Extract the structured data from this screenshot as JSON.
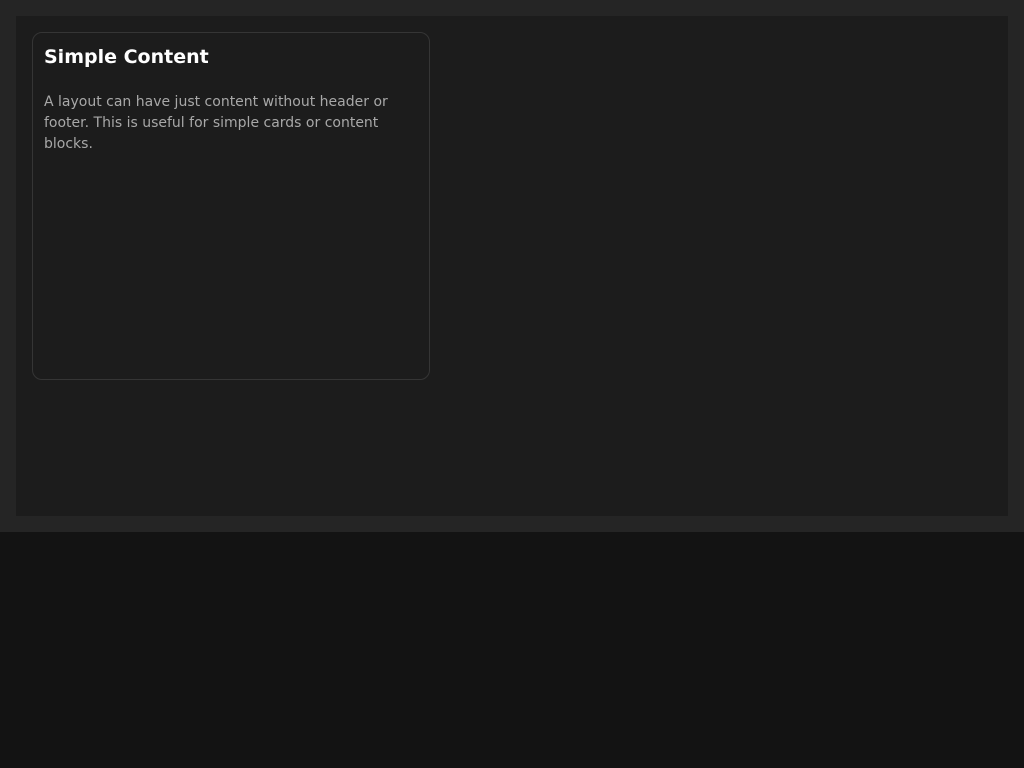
{
  "card": {
    "title": "Simple Content",
    "body": "A layout can have just content without header or footer. This is useful for simple cards or content blocks."
  },
  "colors": {
    "page_background": "#131313",
    "frame_background": "#252525",
    "panel_background": "#1c1c1c",
    "card_border": "#353535",
    "title_color": "#ffffff",
    "body_color": "#a8a8a8"
  }
}
